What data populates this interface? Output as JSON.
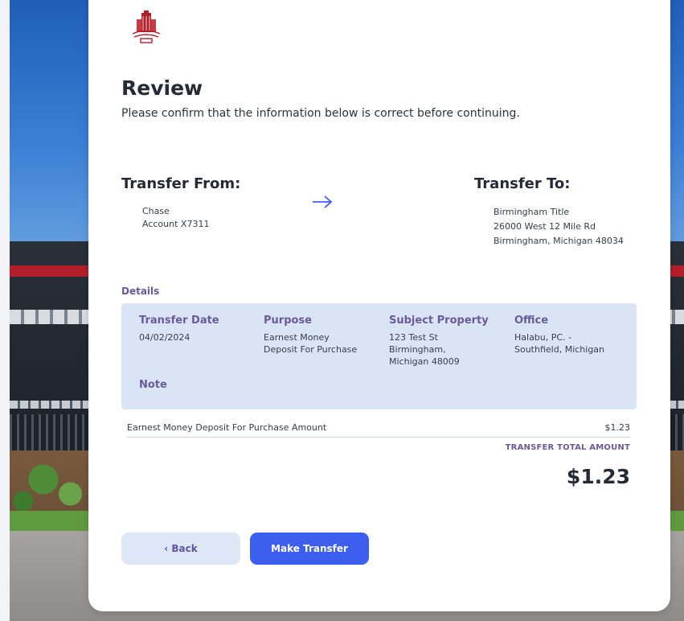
{
  "header": {
    "title": "Review",
    "subtitle": "Please confirm that the information below is correct before continuing."
  },
  "transfer_from": {
    "title": "Transfer From:",
    "bank": "Chase",
    "account": "Account X7311"
  },
  "transfer_to": {
    "title": "Transfer To:",
    "name": "Birmingham Title",
    "address1": "26000 West 12 Mile Rd",
    "address2": "Birmingham, Michigan 48034"
  },
  "details": {
    "label": "Details",
    "transfer_date": {
      "label": "Transfer Date",
      "value": "04/02/2024"
    },
    "purpose": {
      "label": "Purpose",
      "value1": "Earnest Money",
      "value2": "Deposit For Purchase"
    },
    "subject_property": {
      "label": "Subject Property",
      "value1": "123 Test St",
      "value2": "Birmingham,",
      "value3": "Michigan 48009"
    },
    "office": {
      "label": "Office",
      "value1": "Halabu, PC. -",
      "value2": "Southfield, Michigan"
    },
    "note": {
      "label": "Note"
    }
  },
  "amount": {
    "label": "Earnest Money Deposit For Purchase Amount",
    "value": "$1.23"
  },
  "total": {
    "label": "TRANSFER TOTAL AMOUNT",
    "value": "$1.23"
  },
  "buttons": {
    "back": "‹ Back",
    "transfer": "Make Transfer"
  },
  "colors": {
    "accent": "#3d5ff0",
    "label_purple": "#6a5a9a",
    "details_bg": "#d9e5f4",
    "logo_red": "#b0202c"
  },
  "icons": {
    "logo": "building-logo-icon",
    "arrow": "arrow-right-icon"
  }
}
